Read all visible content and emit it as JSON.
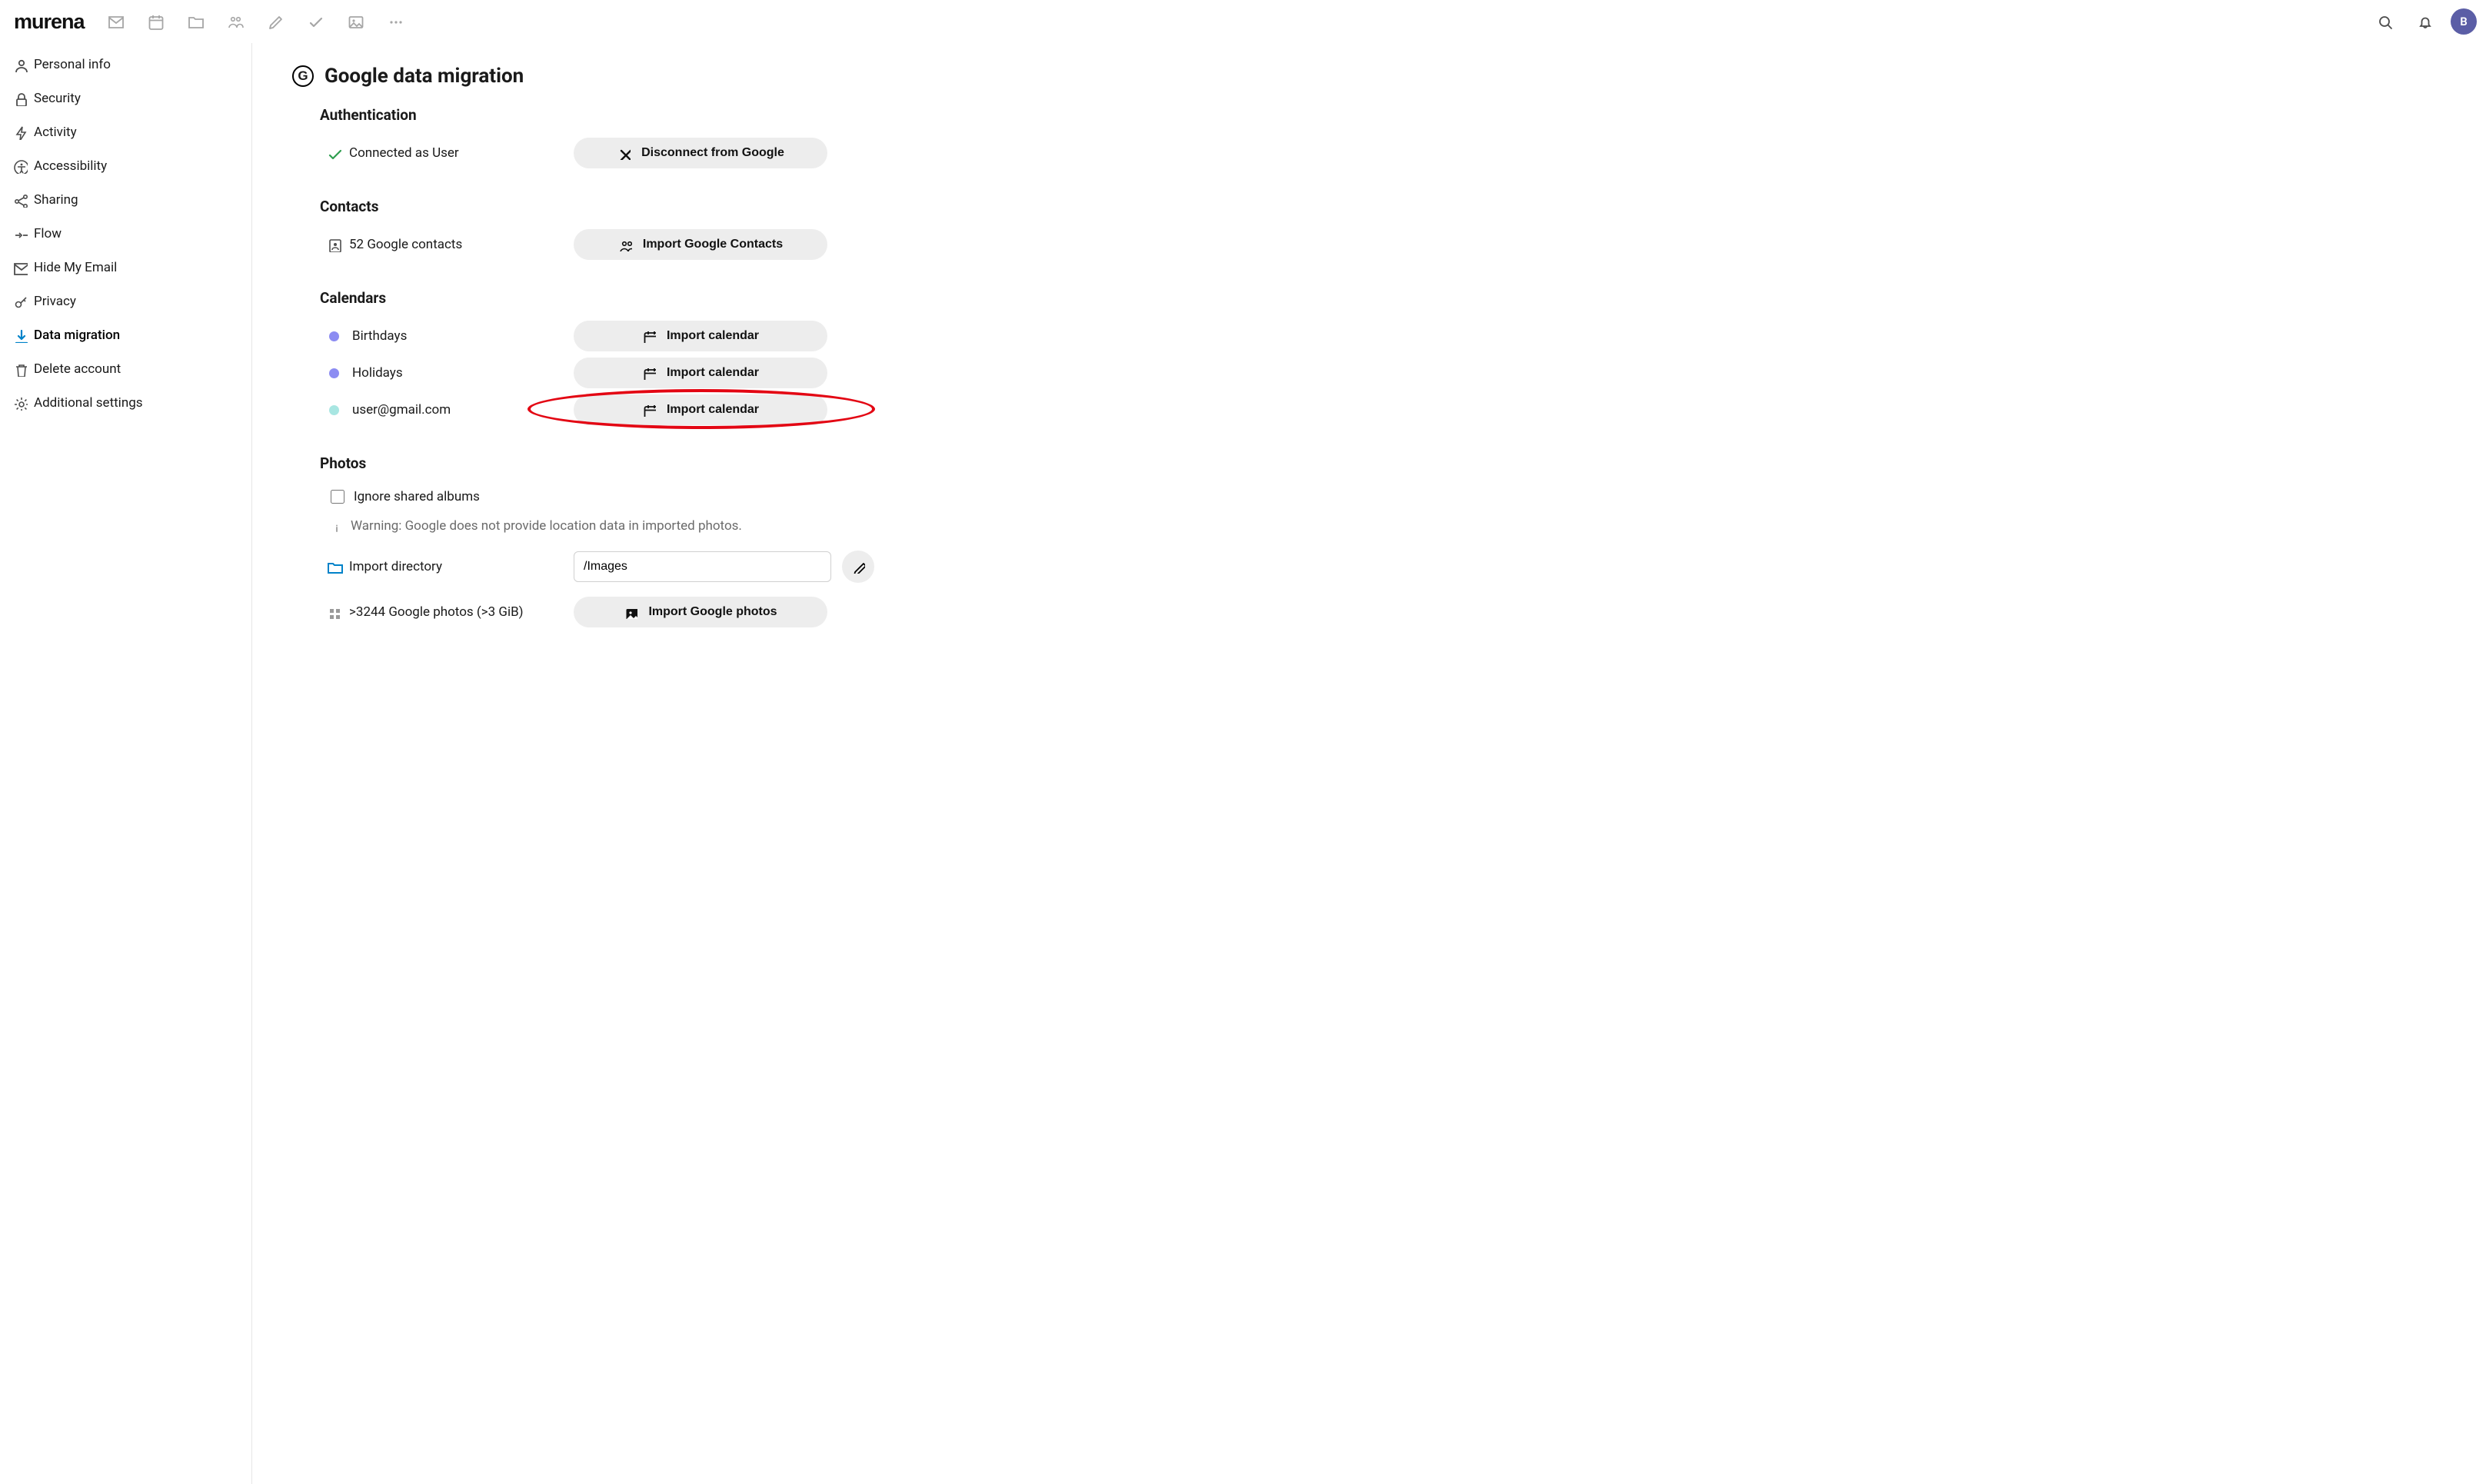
{
  "brand": {
    "name": "murena"
  },
  "avatar": {
    "initial": "B"
  },
  "sidebar": {
    "items": [
      {
        "label": "Personal info"
      },
      {
        "label": "Security"
      },
      {
        "label": "Activity"
      },
      {
        "label": "Accessibility"
      },
      {
        "label": "Sharing"
      },
      {
        "label": "Flow"
      },
      {
        "label": "Hide My Email"
      },
      {
        "label": "Privacy"
      },
      {
        "label": "Data migration"
      },
      {
        "label": "Delete account"
      },
      {
        "label": "Additional settings"
      }
    ]
  },
  "page": {
    "title": "Google data migration",
    "google_badge": "G",
    "auth": {
      "heading": "Authentication",
      "status": "Connected as User",
      "disconnect_btn": "Disconnect from Google"
    },
    "contacts": {
      "heading": "Contacts",
      "count_label": "52 Google contacts",
      "import_btn": "Import Google Contacts"
    },
    "calendars": {
      "heading": "Calendars",
      "items": [
        {
          "name": "Birthdays",
          "dot_color": "#8c8cf2",
          "import_btn": "Import calendar"
        },
        {
          "name": "Holidays",
          "dot_color": "#8c8cf2",
          "import_btn": "Import calendar"
        },
        {
          "name": "user@gmail.com",
          "dot_color": "#a8e6e2",
          "import_btn": "Import calendar"
        }
      ]
    },
    "photos": {
      "heading": "Photos",
      "ignore_label": "Ignore shared albums",
      "warning": "Warning: Google does not provide location data in imported photos.",
      "dir_label": "Import directory",
      "dir_value": "/Images",
      "count_label": ">3244 Google photos (>3 GiB)",
      "import_btn": "Import Google photos"
    }
  }
}
